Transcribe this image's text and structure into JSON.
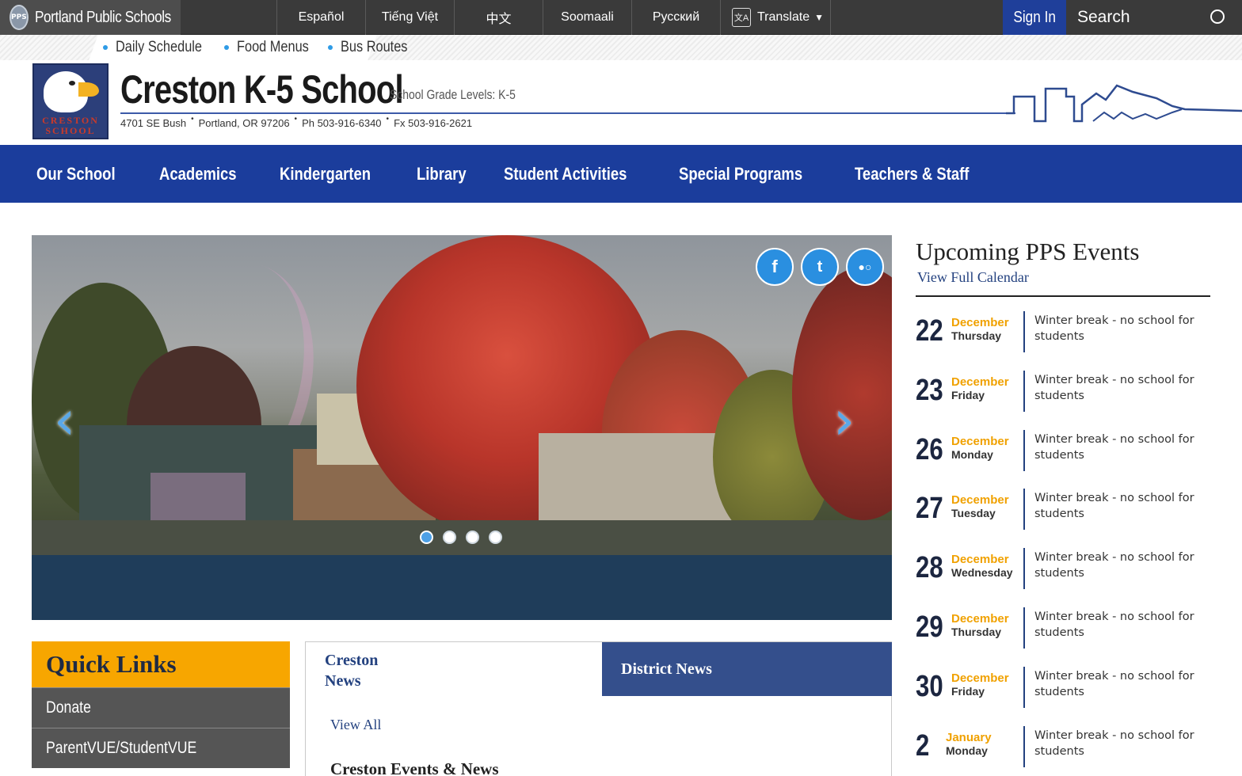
{
  "topbar": {
    "brand": "Portland Public Schools",
    "brand_logo_text": "PPS",
    "languages": [
      "Español",
      "Tiếng Việt",
      "中文",
      "Soomaali",
      "Русский"
    ],
    "translate_label": "Translate",
    "translate_icon_text": "文A",
    "sign_in": "Sign In",
    "search_placeholder": "Search"
  },
  "utility_links": [
    "Daily Schedule",
    "Food Menus",
    "Bus Routes"
  ],
  "header": {
    "school_name": "Creston K-5 School",
    "grade_levels": "School Grade Levels: K-5",
    "logo_text_line1": "CRESTON",
    "logo_text_line2": "SCHOOL",
    "address": [
      "4701 SE Bush",
      "Portland, OR 97206",
      "Ph 503-916-6340",
      "Fx 503-916-2621"
    ]
  },
  "nav": [
    "Our School",
    "Academics",
    "Kindergarten",
    "Library",
    "Student Activities",
    "Special Programs",
    "Teachers & Staff"
  ],
  "hero": {
    "social": [
      {
        "name": "facebook",
        "glyph": "f"
      },
      {
        "name": "twitter",
        "glyph": "t"
      },
      {
        "name": "flickr",
        "glyph": "●○"
      }
    ],
    "prev_glyph": "‹",
    "next_glyph": "›",
    "slide_count": 4,
    "active_slide": 1
  },
  "quick_links": {
    "title": "Quick Links",
    "items": [
      "Donate",
      "ParentVUE/StudentVUE"
    ]
  },
  "news": {
    "tab_active_line1": "Creston",
    "tab_active_line2": "News",
    "tab_other": "District News",
    "view_all": "View All",
    "heading": "Creston Events & News"
  },
  "events": {
    "title": "Upcoming PPS Events",
    "calendar_link": "View Full Calendar",
    "items": [
      {
        "day": "22",
        "month": "December",
        "weekday": "Thursday",
        "desc": "Winter break - no school for students"
      },
      {
        "day": "23",
        "month": "December",
        "weekday": "Friday",
        "desc": "Winter break - no school for students"
      },
      {
        "day": "26",
        "month": "December",
        "weekday": "Monday",
        "desc": "Winter break - no school for students"
      },
      {
        "day": "27",
        "month": "December",
        "weekday": "Tuesday",
        "desc": "Winter break - no school for students"
      },
      {
        "day": "28",
        "month": "December",
        "weekday": "Wednesday",
        "desc": "Winter break - no school for students"
      },
      {
        "day": "29",
        "month": "December",
        "weekday": "Thursday",
        "desc": "Winter break - no school for students"
      },
      {
        "day": "30",
        "month": "December",
        "weekday": "Friday",
        "desc": "Winter break - no school for students"
      },
      {
        "day": "2",
        "month": "January",
        "weekday": "Monday",
        "desc": "Winter break - no school for students"
      }
    ]
  },
  "colors": {
    "nav_blue": "#1b3d9c",
    "accent_orange": "#f7a600",
    "event_month": "#f0a100",
    "link_blue": "#23417f",
    "hero_caption": "#1f3d5a"
  }
}
